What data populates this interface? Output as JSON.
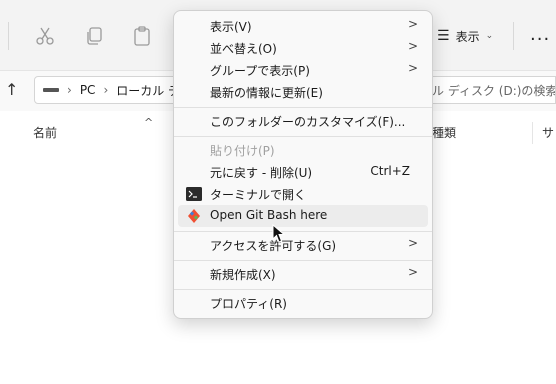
{
  "colors": {
    "menu_bg": "#f9f9f9",
    "hover_bg": "#ececec",
    "disabled_text": "#a0a0a0"
  },
  "toolbar": {
    "icons": [
      "cut-icon",
      "copy-icon",
      "paste-icon"
    ],
    "view_label": "表示",
    "more_label": "..."
  },
  "address": {
    "crumbs": [
      "PC",
      "ローカル ディ"
    ],
    "search_placeholder": "ル ディスク (D:)の検索"
  },
  "columns": {
    "name": "名前",
    "type": "種類",
    "size": "サ"
  },
  "menu": {
    "items": [
      {
        "label": "表示(V)",
        "submenu": true
      },
      {
        "label": "並べ替え(O)",
        "submenu": true
      },
      {
        "label": "グループで表示(P)",
        "submenu": true
      },
      {
        "label": "最新の情報に更新(E)"
      },
      {
        "label": "このフォルダーのカスタマイズ(F)..."
      },
      {
        "label": "貼り付け(P)",
        "disabled": true
      },
      {
        "label": "元に戻す - 削除(U)",
        "shortcut": "Ctrl+Z"
      },
      {
        "label": "ターミナルで開く",
        "icon": "terminal-icon"
      },
      {
        "label": "Open Git Bash here",
        "icon": "git-icon"
      },
      {
        "label": "アクセスを許可する(G)",
        "submenu": true
      },
      {
        "label": "新規作成(X)",
        "submenu": true
      },
      {
        "label": "プロパティ(R)"
      }
    ],
    "chevron": ">"
  }
}
